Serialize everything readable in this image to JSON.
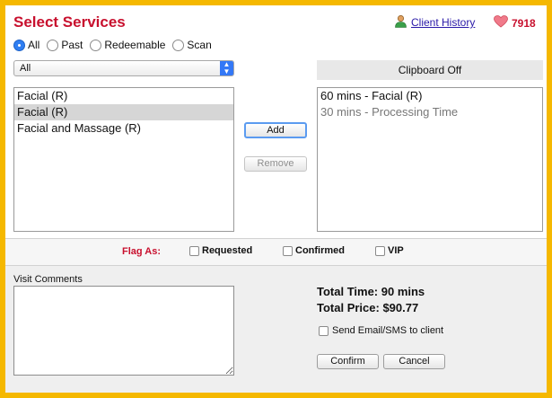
{
  "header": {
    "title": "Select Services",
    "client_history_label": "Client History",
    "points_value": "7918"
  },
  "filters": {
    "options": [
      "All",
      "Past",
      "Redeemable",
      "Scan"
    ],
    "selected": "All"
  },
  "category_select": {
    "value": "All"
  },
  "services": {
    "items": [
      "Facial (R)",
      "Facial (R)",
      "Facial and Massage (R)"
    ],
    "selected_index": 1
  },
  "buttons": {
    "add_label": "Add",
    "remove_label": "Remove",
    "confirm_label": "Confirm",
    "cancel_label": "Cancel"
  },
  "clipboard": {
    "header": "Clipboard Off",
    "items": [
      {
        "text": "60 mins - Facial (R)",
        "style": "normal"
      },
      {
        "text": "30 mins - Processing Time",
        "style": "dim"
      }
    ]
  },
  "flags": {
    "label": "Flag As:",
    "options": [
      "Requested",
      "Confirmed",
      "VIP"
    ]
  },
  "visit_comments": {
    "label": "Visit Comments",
    "value": ""
  },
  "totals": {
    "time": "Total Time: 90 mins",
    "price": "Total Price: $90.77"
  },
  "notify": {
    "label": "Send Email/SMS to client"
  },
  "colors": {
    "accent_red": "#c8102e",
    "frame": "#f5b800",
    "link": "#2a1aa8",
    "radio_selected": "#2f7ef2"
  }
}
